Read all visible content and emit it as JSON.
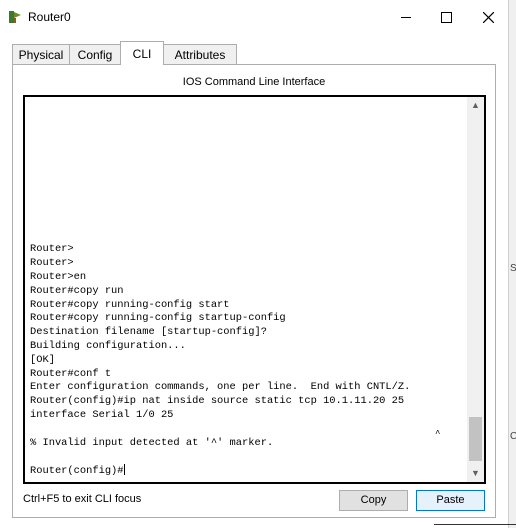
{
  "window": {
    "title": "Router0",
    "icon": "router-tree-icon"
  },
  "tabs": [
    {
      "label": "Physical",
      "active": false
    },
    {
      "label": "Config",
      "active": false
    },
    {
      "label": "CLI",
      "active": true
    },
    {
      "label": "Attributes",
      "active": false
    }
  ],
  "panel": {
    "title": "IOS Command Line Interface"
  },
  "terminal": {
    "lines": [
      "Router>",
      "Router>",
      "Router>en",
      "Router#copy run",
      "Router#copy running-config start",
      "Router#copy running-config startup-config",
      "Destination filename [startup-config]?",
      "Building configuration...",
      "[OK]",
      "Router#conf t",
      "Enter configuration commands, one per line.  End with CNTL/Z.",
      "Router(config)#ip nat inside source static tcp 10.1.11.20 25",
      "interface Serial 1/0 25",
      "",
      "% Invalid input detected at '^' marker.",
      "",
      "Router(config)#"
    ],
    "error_marker": "^"
  },
  "footer": {
    "hint": "Ctrl+F5 to exit CLI focus",
    "copy_label": "Copy",
    "paste_label": "Paste"
  },
  "edge": {
    "glyph_top": "S",
    "glyph_bottom": "C"
  },
  "colors": {
    "focus_border": "#0078d7",
    "panel_border": "#adadad"
  }
}
